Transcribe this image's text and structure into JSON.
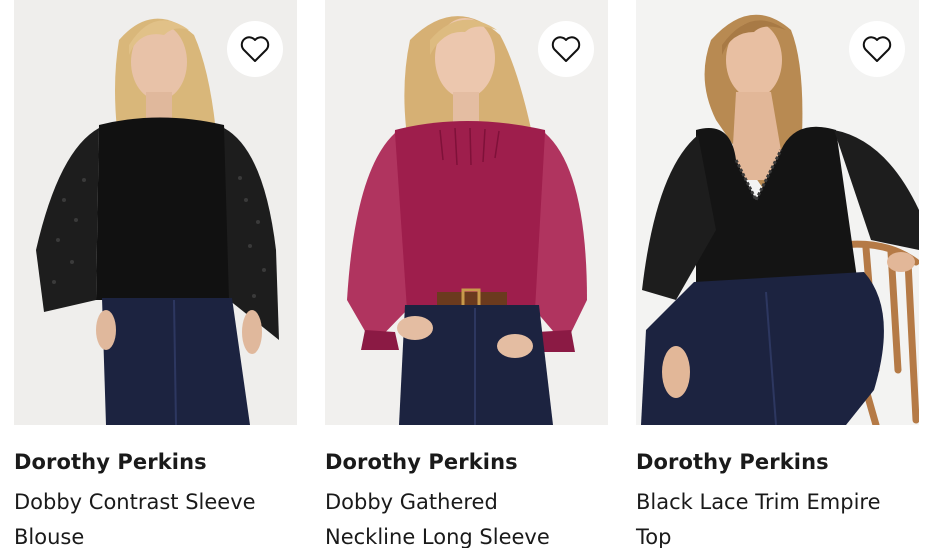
{
  "products": [
    {
      "brand": "Dorothy Perkins",
      "title_lines": [
        "Dobby Contrast Sleeve",
        "Blouse"
      ],
      "image_icon": "model-black-blouse",
      "wishlist_icon": "heart-outline-icon",
      "top_color": "#111111"
    },
    {
      "brand": "Dorothy Perkins",
      "title_lines": [
        "Dobby Gathered",
        "Neckline Long Sleeve"
      ],
      "image_icon": "model-berry-blouse",
      "wishlist_icon": "heart-outline-icon",
      "top_color": "#9e1e4c"
    },
    {
      "brand": "Dorothy Perkins",
      "title_lines": [
        "Black Lace Trim Empire",
        "Top"
      ],
      "image_icon": "model-black-empire-top",
      "wishlist_icon": "heart-outline-icon",
      "top_color": "#141414"
    }
  ],
  "colors": {
    "denim": "#1c2340",
    "skin": "#e8c2a8",
    "hair": "#d9b77a",
    "background": "#efeeec"
  }
}
